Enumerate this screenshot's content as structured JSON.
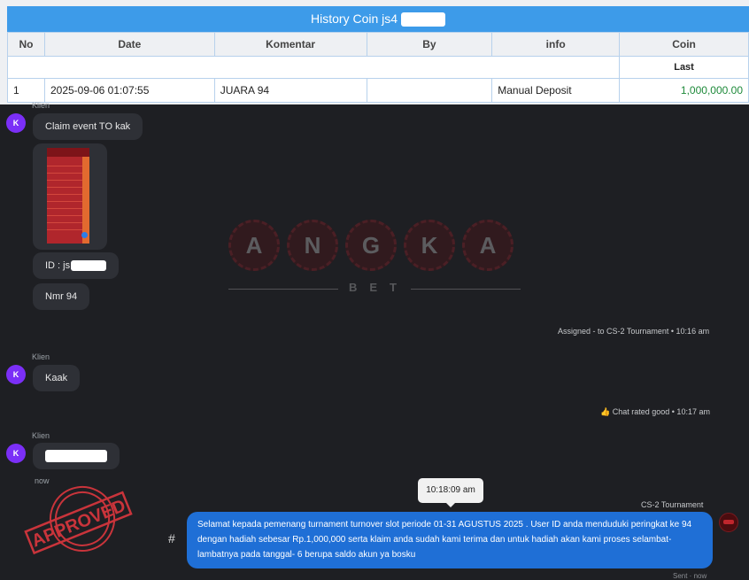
{
  "history": {
    "title": "History Coin js4",
    "columns": [
      "No",
      "Date",
      "Komentar",
      "By",
      "info",
      "Coin"
    ],
    "subheader": "Last",
    "rows": [
      {
        "no": "1",
        "date": "2025-09-06 01:07:55",
        "komentar": "JUARA 94",
        "by": "",
        "info": "Manual Deposit",
        "coin": "1,000,000.00"
      }
    ]
  },
  "chat": {
    "sender_label": "Klien",
    "avatar_letter": "K",
    "messages": {
      "m1": "Claim event TO kak",
      "m2": "ID : js",
      "m3": "Nmr 94",
      "m4": "Kaak"
    },
    "system": {
      "assigned": "Assigned - to CS-2 Tournament • 10:16 am",
      "rated": "Chat rated good • 10:17 am"
    },
    "now_label": "now",
    "tooltip_time": "10:18:09 am",
    "agent_name": "CS-2 Tournament",
    "agent_message": "Selamat kepada pemenang turnament turnover slot periode 01-31 AGUSTUS 2025 . User ID anda menduduki peringkat ke 94 dengan hadiah sebesar Rp.1,000,000 serta klaim anda sudah kami terima dan untuk hadiah akan kami proses selambat-lambatnya pada tanggal- 6 berupa saldo akun ya bosku",
    "hash_icon": "#",
    "sent_label": "Sent · now"
  },
  "watermark": {
    "letters": [
      "A",
      "N",
      "G",
      "K",
      "A"
    ],
    "sub": "BET"
  },
  "stamp": {
    "text": "APPROVED",
    "color": "#c9343b"
  },
  "colors": {
    "header_blue": "#3d9be9",
    "avatar_purple": "#7b2ff7",
    "bubble_blue": "#1f6fd6",
    "coin_green": "#1e8a3a"
  }
}
